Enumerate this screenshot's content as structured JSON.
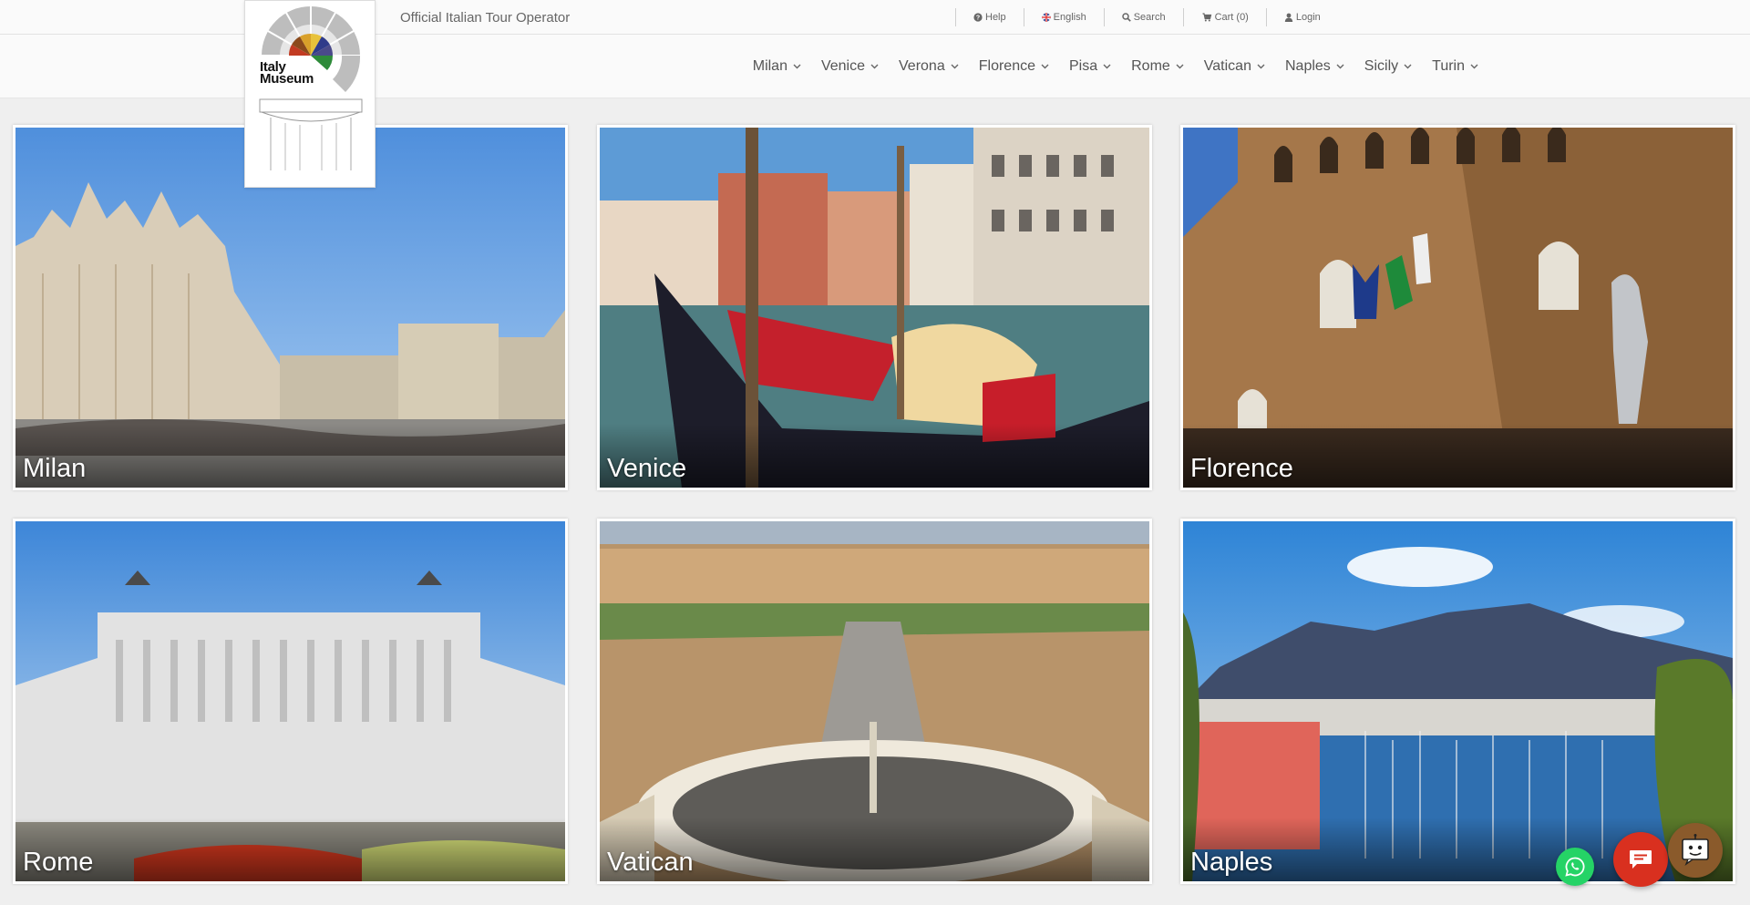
{
  "header": {
    "tagline": "Official Italian Tour Operator",
    "logo_text_line1": "Italy",
    "logo_text_line2": "Museum",
    "utility": [
      {
        "label": "Help",
        "icon": "question-circle-icon"
      },
      {
        "label": "English",
        "icon": "uk-flag-icon"
      },
      {
        "label": "Search",
        "icon": "search-icon"
      },
      {
        "label": "Cart (0)",
        "icon": "cart-icon"
      },
      {
        "label": "Login",
        "icon": "user-icon"
      }
    ]
  },
  "nav": {
    "items": [
      "Milan",
      "Venice",
      "Verona",
      "Florence",
      "Pisa",
      "Rome",
      "Vatican",
      "Naples",
      "Sicily",
      "Turin"
    ]
  },
  "cities": [
    {
      "name": "Milan"
    },
    {
      "name": "Venice"
    },
    {
      "name": "Florence"
    },
    {
      "name": "Rome"
    },
    {
      "name": "Vatican"
    },
    {
      "name": "Naples"
    }
  ],
  "floating": {
    "whatsapp_icon": "whatsapp-icon",
    "chat_icon": "chat-bubble-icon",
    "bot_icon": "chatbot-icon"
  },
  "colors": {
    "accent_red": "#d9301f",
    "whatsapp_green": "#25d366",
    "bot_brown": "#8a5a2b"
  }
}
